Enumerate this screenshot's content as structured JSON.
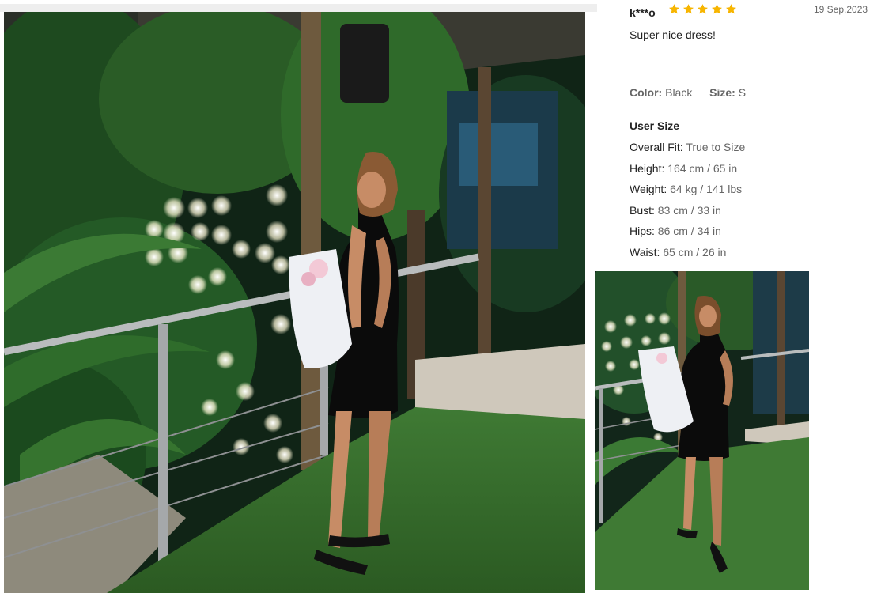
{
  "review": {
    "reviewer": "k***o",
    "rating": 5,
    "date": "19 Sep,2023",
    "text": "Super nice dress!",
    "color_label": "Color:",
    "color_value": "Black",
    "size_label": "Size:",
    "size_value": "S",
    "user_size_title": "User Size",
    "measurements": [
      {
        "label": "Overall Fit:",
        "value": "True to Size"
      },
      {
        "label": "Height:",
        "value": "164 cm / 65 in"
      },
      {
        "label": "Weight:",
        "value": "64 kg / 141 lbs"
      },
      {
        "label": "Bust:",
        "value": "83 cm / 33 in"
      },
      {
        "label": "Hips:",
        "value": "86 cm / 34 in"
      },
      {
        "label": "Waist:",
        "value": "65 cm / 26 in"
      }
    ]
  },
  "colors": {
    "star": "#f7b500",
    "label": "#666666",
    "text": "#222222"
  },
  "icons": {
    "star": "star-icon"
  }
}
